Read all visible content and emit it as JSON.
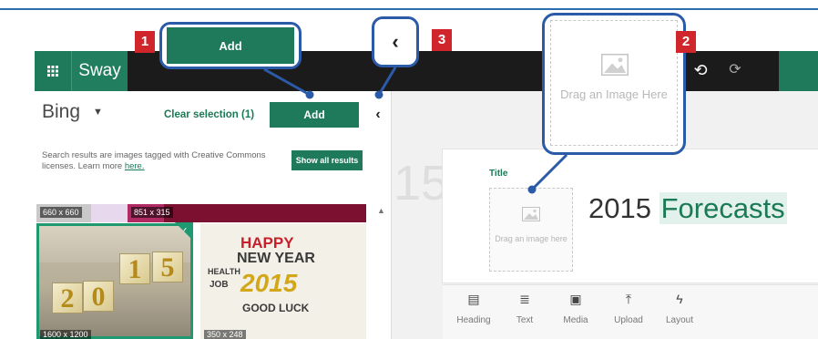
{
  "app": {
    "name": "Sway"
  },
  "left_panel": {
    "source_label": "Bing",
    "clear_selection": "Clear selection (1)",
    "add_label": "Add",
    "notice_text": "Search results are images tagged with Creative Commons licenses. Learn more",
    "notice_link": "here.",
    "show_all": "Show all results",
    "strip_labels": [
      "660 x 660",
      "851 x 315"
    ],
    "results": [
      {
        "size": "1600 x 1200",
        "selected": true,
        "digits": [
          "2",
          "0",
          "1",
          "5"
        ]
      },
      {
        "size": "350 x 248",
        "selected": false,
        "words": [
          "HAPPY",
          "NEW YEAR",
          "2015",
          "GOOD LUCK",
          "HEALTH",
          "JOB"
        ]
      }
    ]
  },
  "canvas": {
    "ghost_text": "15",
    "title_tag": "Title",
    "drop_placeholder": "Drag an image here",
    "heading_main": "2015 ",
    "heading_accent": "Forecasts",
    "toolbar": [
      {
        "label": "Heading",
        "icon": "heading-icon",
        "glyph": "▤"
      },
      {
        "label": "Text",
        "icon": "text-icon",
        "glyph": "≣"
      },
      {
        "label": "Media",
        "icon": "media-icon",
        "glyph": "▣"
      },
      {
        "label": "Upload",
        "icon": "upload-icon",
        "glyph": "⤒"
      },
      {
        "label": "Layout",
        "icon": "layout-icon",
        "glyph": "ϟ"
      }
    ]
  },
  "callouts": {
    "add": {
      "number": "1",
      "label": "Add"
    },
    "drag": {
      "number": "2",
      "text": "Drag an Image Here"
    },
    "back": {
      "number": "3",
      "glyph": "‹"
    }
  },
  "colors": {
    "accent": "#1f7a5c",
    "callout": "#2b5aa8",
    "badge": "#d0262b"
  }
}
